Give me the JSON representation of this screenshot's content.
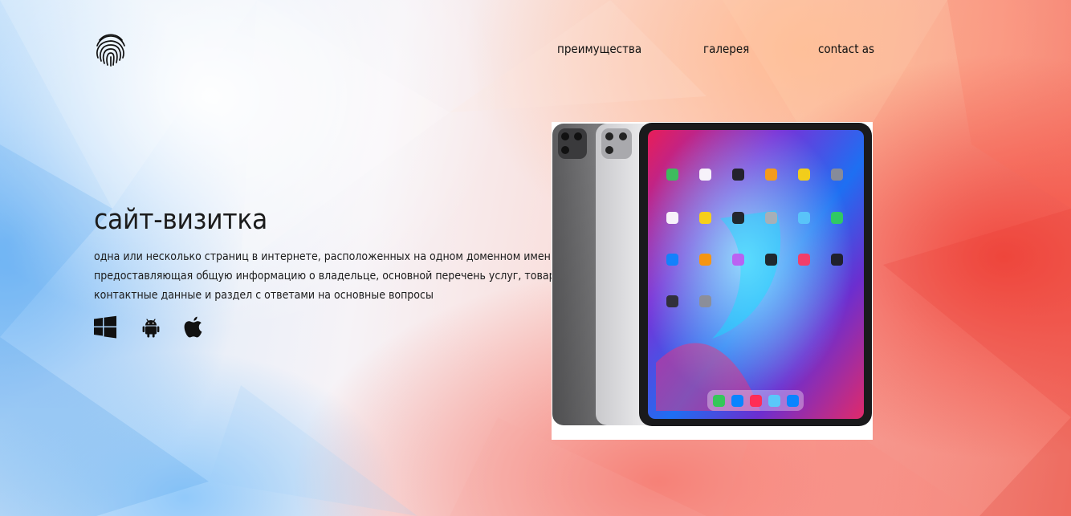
{
  "header": {
    "logo_icon": "fingerprint-icon",
    "nav": [
      {
        "label": "преимущества"
      },
      {
        "label": "галерея"
      },
      {
        "label": "contact as"
      }
    ]
  },
  "hero": {
    "title": "сайт-визитка",
    "description_lines": [
      "одна или несколько страниц в интернете, расположенных на одном доменном имени,",
      "предоставляющая общую информацию о владельце, основной перечень услуг, товаров,",
      "контактные данные и раздел с ответами на основные вопросы"
    ],
    "platforms": [
      {
        "icon": "windows-icon"
      },
      {
        "icon": "android-icon"
      },
      {
        "icon": "apple-icon"
      }
    ],
    "image_icon": "ipad-pro-image"
  },
  "colors": {
    "text": "#1c1c1c",
    "bg_blue": "#6eb4f5",
    "bg_red": "#f0463c"
  }
}
